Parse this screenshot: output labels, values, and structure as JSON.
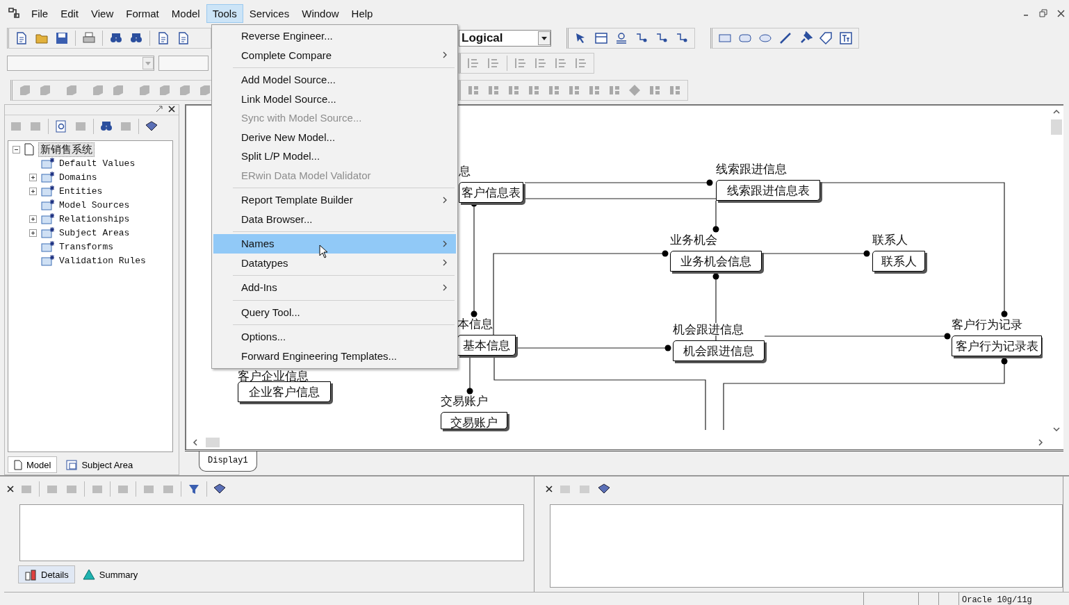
{
  "menu_bar": {
    "items": [
      {
        "label": "File",
        "selected": false
      },
      {
        "label": "Edit",
        "selected": false
      },
      {
        "label": "View",
        "selected": false
      },
      {
        "label": "Format",
        "selected": false
      },
      {
        "label": "Model",
        "selected": false
      },
      {
        "label": "Tools",
        "selected": true
      },
      {
        "label": "Services",
        "selected": false
      },
      {
        "label": "Window",
        "selected": false
      },
      {
        "label": "Help",
        "selected": false
      }
    ]
  },
  "toolbar": {
    "view_mode": "Logical"
  },
  "model_explorer": {
    "tree": [
      {
        "label": "新销售系统",
        "expanded": true,
        "selected": true,
        "children": [
          {
            "label": "Default Values",
            "selected": false
          },
          {
            "label": "Domains",
            "expanded": false,
            "selected": false
          },
          {
            "label": "Entities",
            "expanded": false,
            "selected": false
          },
          {
            "label": "Model Sources",
            "selected": false
          },
          {
            "label": "Relationships",
            "expanded": false,
            "selected": false
          },
          {
            "label": "Subject Areas",
            "expanded": false,
            "selected": false
          },
          {
            "label": "Transforms",
            "selected": false
          },
          {
            "label": "Validation Rules",
            "selected": false
          }
        ]
      }
    ],
    "tabs": [
      {
        "label": "Model",
        "selected": true
      },
      {
        "label": "Subject Area",
        "selected": false
      }
    ]
  },
  "diagram": {
    "entities": [
      {
        "name": "息",
        "table": "客户信息表"
      },
      {
        "name": "线索跟进信息",
        "table": "线索跟进信息表"
      },
      {
        "name": "业务机会",
        "table": "业务机会信息"
      },
      {
        "name": "联系人",
        "table": "联系人"
      },
      {
        "name": "本信息",
        "table": "基本信息"
      },
      {
        "name": "机会跟进信息",
        "table": "机会跟进信息"
      },
      {
        "name": "客户行为记录",
        "table": "客户行为记录表"
      },
      {
        "name": "客户企业信息",
        "table": "企业客户信息"
      },
      {
        "name": "交易账户",
        "table": "交易账户"
      }
    ],
    "tabs": [
      {
        "label": "Display1",
        "selected": true
      }
    ]
  },
  "tools_menu": {
    "items": [
      {
        "kind": "item",
        "label": "Reverse Engineer...",
        "disabled": false,
        "selected": false,
        "submenu": false
      },
      {
        "kind": "item",
        "label": "Complete Compare",
        "disabled": false,
        "selected": false,
        "submenu": true
      },
      {
        "kind": "separator"
      },
      {
        "kind": "item",
        "label": "Add Model Source...",
        "disabled": false,
        "selected": false,
        "submenu": false
      },
      {
        "kind": "item",
        "label": "Link Model Source...",
        "disabled": false,
        "selected": false,
        "submenu": false
      },
      {
        "kind": "item",
        "label": "Sync with Model Source...",
        "disabled": true,
        "selected": false,
        "submenu": false
      },
      {
        "kind": "item",
        "label": "Derive New Model...",
        "disabled": false,
        "selected": false,
        "submenu": false
      },
      {
        "kind": "item",
        "label": "Split L/P Model...",
        "disabled": false,
        "selected": false,
        "submenu": false
      },
      {
        "kind": "item",
        "label": "ERwin Data Model Validator",
        "disabled": true,
        "selected": false,
        "submenu": false
      },
      {
        "kind": "separator"
      },
      {
        "kind": "item",
        "label": "Report Template Builder",
        "disabled": false,
        "selected": false,
        "submenu": true
      },
      {
        "kind": "item",
        "label": "Data Browser...",
        "disabled": false,
        "selected": false,
        "submenu": false
      },
      {
        "kind": "separator"
      },
      {
        "kind": "item",
        "label": "Names",
        "disabled": false,
        "selected": true,
        "submenu": true
      },
      {
        "kind": "item",
        "label": "Datatypes",
        "disabled": false,
        "selected": false,
        "submenu": true
      },
      {
        "kind": "separator"
      },
      {
        "kind": "item",
        "label": "Add-Ins",
        "disabled": false,
        "selected": false,
        "submenu": true
      },
      {
        "kind": "separator"
      },
      {
        "kind": "item",
        "label": "Query Tool...",
        "disabled": false,
        "selected": false,
        "submenu": false
      },
      {
        "kind": "separator"
      },
      {
        "kind": "item",
        "label": "Options...",
        "disabled": false,
        "selected": false,
        "submenu": false
      },
      {
        "kind": "item",
        "label": "Forward Engineering Templates...",
        "disabled": false,
        "selected": false,
        "submenu": false
      }
    ]
  },
  "bottom_panel": {
    "tabs": [
      {
        "label": "Details",
        "selected": true
      },
      {
        "label": "Summary",
        "selected": false
      }
    ]
  },
  "status_bar": {
    "database": "Oracle 10g/11g"
  }
}
